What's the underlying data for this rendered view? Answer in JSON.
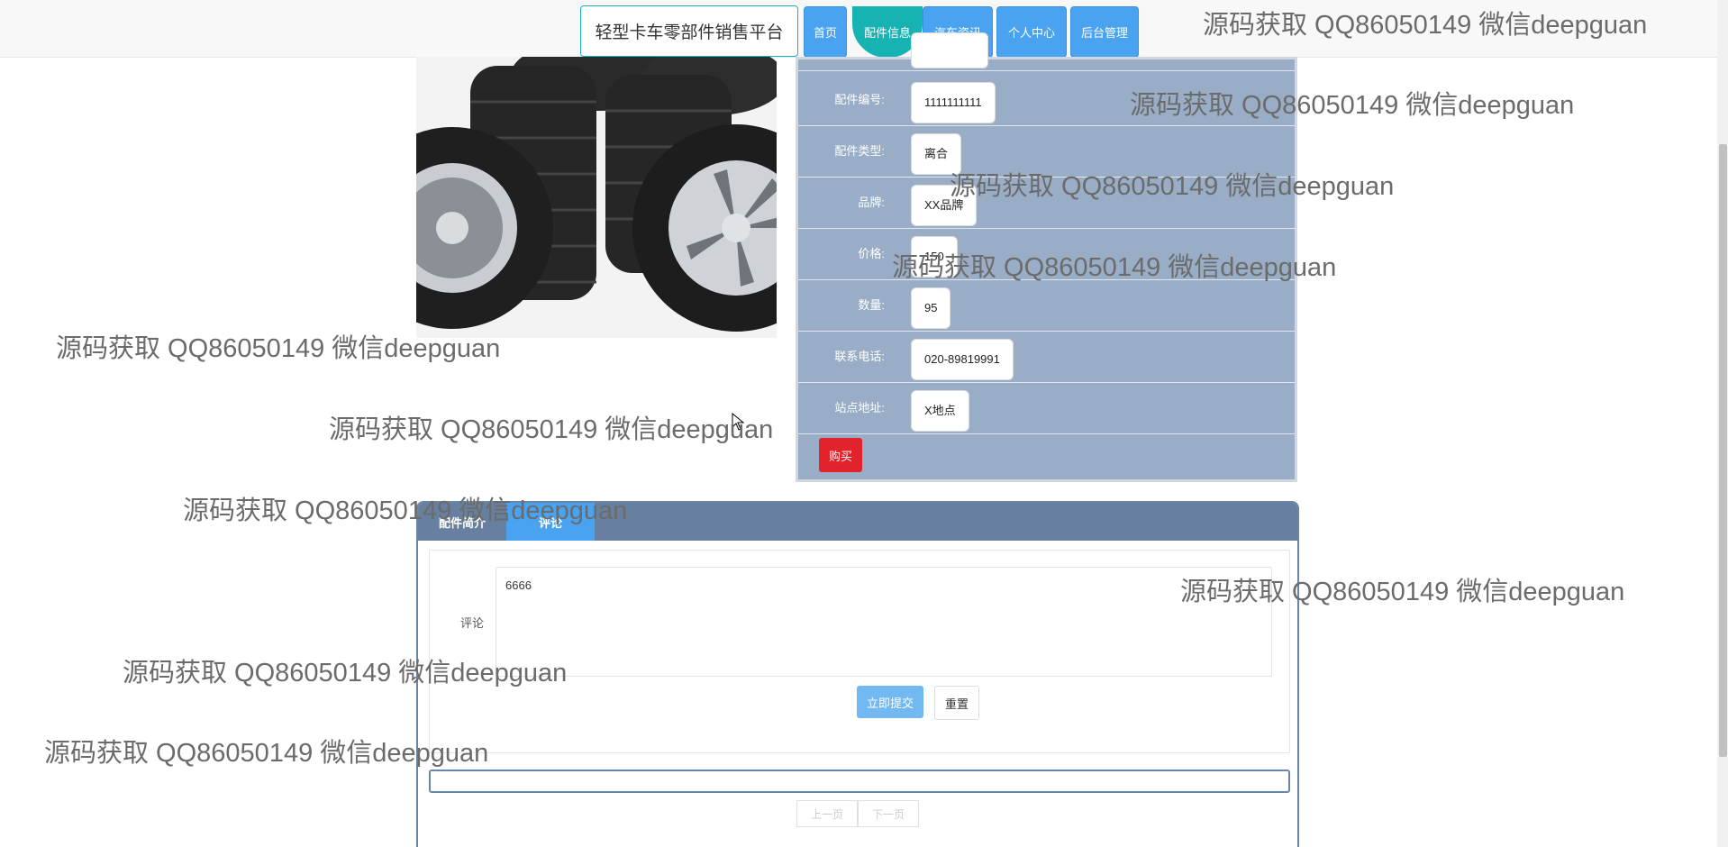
{
  "nav": {
    "brand": "轻型卡车零部件销售平台",
    "items": [
      {
        "label": "首页"
      },
      {
        "label": "配件信息"
      },
      {
        "label": "汽车资讯"
      },
      {
        "label": "个人中心"
      },
      {
        "label": "后台管理"
      }
    ]
  },
  "product": {
    "image_alt": "tires",
    "fields": [
      {
        "label": "配件编号:",
        "value": "1111111111"
      },
      {
        "label": "配件类型:",
        "value": "离合"
      },
      {
        "label": "品牌:",
        "value": "XX品牌"
      },
      {
        "label": "价格:",
        "value": "150"
      },
      {
        "label": "数量:",
        "value": "95"
      },
      {
        "label": "联系电话:",
        "value": "020-89819991"
      },
      {
        "label": "站点地址:",
        "value": "X地点"
      }
    ],
    "buy_label": "购买"
  },
  "tabs": [
    {
      "label": "配件简介"
    },
    {
      "label": "评论"
    }
  ],
  "comment": {
    "label": "评论",
    "value": "6666",
    "submit_label": "立即提交",
    "reset_label": "重置"
  },
  "pager": {
    "prev": "上一页",
    "next": "下一页"
  },
  "watermark": "源码获取 QQ86050149 微信deepguan",
  "colors": {
    "nav_button": "#4aa3f0",
    "nav_active": "#17b3b2",
    "panel": "#99aec6",
    "buy": "#e3232b",
    "tab_header": "#6880a0"
  }
}
